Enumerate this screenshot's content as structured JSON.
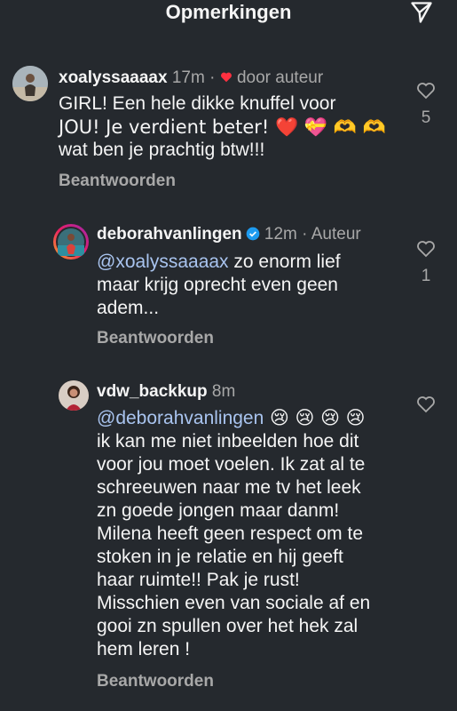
{
  "header": {
    "title": "Opmerkingen",
    "send_icon": "paper-plane-icon"
  },
  "comments": [
    {
      "username": "xoalyssaaaax",
      "time": "17m",
      "tag_prefix": "·",
      "tag": "door auteur",
      "lines": [
        "GIRL! Een hele dikke knuffel voor",
        "JOU! Je verdient beter! ❤️ 💝 🫶 🫶",
        "wat ben je prachtig btw!!!"
      ],
      "reply_label": "Beantwoorden",
      "like_count": "5"
    },
    {
      "username": "deborahvanlingen",
      "time": "12m",
      "tag": "· Auteur",
      "mention": "@xoalyssaaaax",
      "lines_first_rest": " zo enorm lief",
      "lines": [
        "maar krijg oprecht even geen",
        "adem..."
      ],
      "reply_label": "Beantwoorden",
      "like_count": "1"
    },
    {
      "username": "vdw_backkup",
      "time": "8m",
      "mention": "@deborahvanlingen",
      "lines_first_rest": " 😢 😢 😢 😢",
      "lines": [
        "ik kan me niet inbeelden hoe dit",
        "voor jou moet voelen. Ik zat al te",
        "schreeuwen naar me tv het leek",
        "zn goede jongen maar danm!",
        "Milena heeft geen respect om te",
        "stoken in je relatie en hij geeft",
        "haar ruimte!! Pak je rust!",
        "Misschien even van sociale af  en",
        "gooi zn spullen over het hek zal",
        "hem leren !"
      ],
      "reply_label": "Beantwoorden"
    }
  ]
}
